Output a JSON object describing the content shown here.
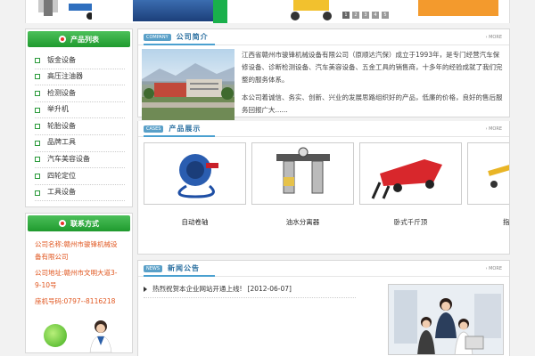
{
  "banner": {
    "slider_dots": [
      "1",
      "2",
      "3",
      "4",
      "5"
    ]
  },
  "sidebar": {
    "products_title": "产品列表",
    "categories": [
      "钣金设备",
      "高压注油器",
      "检测设备",
      "举升机",
      "轮胎设备",
      "品牌工具",
      "汽车美容设备",
      "四轮定位",
      "工具设备"
    ],
    "contact_title": "联系方式",
    "contact_lines": [
      "公司名称:赣州市骏锋机械设备有限公司",
      "公司地址:赣州市文明大道3-9-10号",
      "座机号码:0797--8116218"
    ]
  },
  "company": {
    "tag": "company",
    "title": "公司简介",
    "more": "MORE",
    "para1": "江西省赣州市骏锋机械设备有限公司（原顺达汽保）成立于1993年，是专门经营汽车保修设备、诊断检测设备、汽车美容设备、五金工具的销售商，十多年的经验成就了我们完整的服务体系。",
    "para2": "本公司着诚信、务实、创新、兴业的发展思路组织好的产品，低廉的价格，良好的售后服务回报广大......"
  },
  "products": {
    "tag": "cases",
    "title": "产品展示",
    "more": "MORE",
    "items": [
      "自动卷轴",
      "油水分离器",
      "卧式千斤顶",
      "指"
    ]
  },
  "news": {
    "tag": "news",
    "title": "新闻公告",
    "more": "MORE",
    "items": [
      {
        "title": "热烈祝贺本企业网站开通上线!",
        "date": "[2012-06-07]"
      }
    ]
  },
  "colors": {
    "green": "#1f9a2e",
    "blue_title": "#2a6fa0",
    "contact_orange": "#e0561f"
  }
}
